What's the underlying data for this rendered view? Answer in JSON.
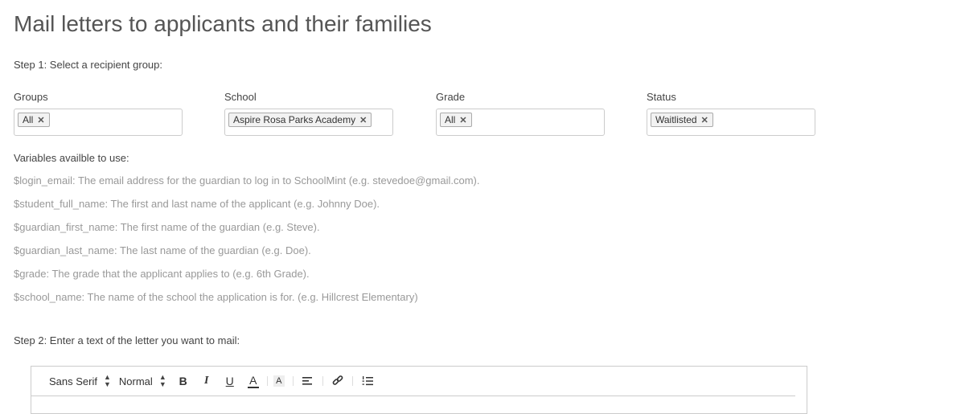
{
  "page": {
    "title": "Mail letters to applicants and their families"
  },
  "step1": {
    "label": "Step 1: Select a recipient group:"
  },
  "filters": [
    {
      "label": "Groups",
      "tags": [
        "All"
      ]
    },
    {
      "label": "School",
      "tags": [
        "Aspire Rosa Parks Academy"
      ]
    },
    {
      "label": "Grade",
      "tags": [
        "All"
      ]
    },
    {
      "label": "Status",
      "tags": [
        "Waitlisted"
      ]
    }
  ],
  "variables": {
    "title": "Variables availble to use:",
    "items": [
      "$login_email: The email address for the guardian to log in to SchoolMint (e.g. stevedoe@gmail.com).",
      "$student_full_name: The first and last name of the applicant (e.g. Johnny Doe).",
      "$guardian_first_name: The first name of the guardian (e.g. Steve).",
      "$guardian_last_name: The last name of the guardian (e.g. Doe).",
      "$grade: The grade that the applicant applies to (e.g. 6th Grade).",
      "$school_name: The name of the school the application is for. (e.g. Hillcrest Elementary)"
    ]
  },
  "step2": {
    "label": "Step 2: Enter a text of the letter you want to mail:"
  },
  "editor": {
    "font_select": "Sans Serif",
    "size_select": "Normal",
    "bold_label": "B",
    "italic_label": "I",
    "underline_label": "U",
    "text_color_label": "A",
    "background_label": "A",
    "icons": [
      "align-icon",
      "link-icon",
      "ordered-list-icon"
    ]
  }
}
